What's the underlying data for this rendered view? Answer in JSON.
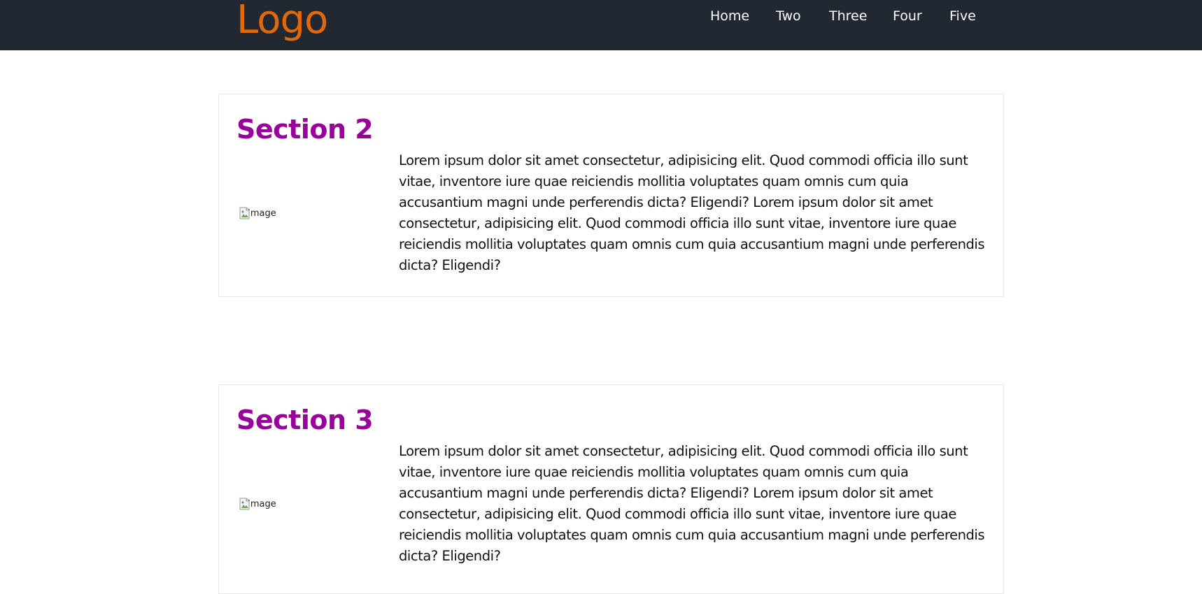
{
  "header": {
    "logo": "Logo",
    "nav": [
      {
        "label": "Home"
      },
      {
        "label": "Two"
      },
      {
        "label": "Three"
      },
      {
        "label": "Four"
      },
      {
        "label": "Five"
      }
    ]
  },
  "sections": [
    {
      "title": "Section 2",
      "image_alt": "Image",
      "text": "Lorem ipsum dolor sit amet consectetur, adipisicing elit. Quod commodi officia illo sunt vitae, inventore iure quae reiciendis mollitia voluptates quam omnis cum quia accusantium magni unde perferendis dicta? Eligendi? Lorem ipsum dolor sit amet consectetur, adipisicing elit. Quod commodi officia illo sunt vitae, inventore iure quae reiciendis mollitia voluptates quam omnis cum quia accusantium magni unde perferendis dicta? Eligendi?"
    },
    {
      "title": "Section 3",
      "image_alt": "Image",
      "text": "Lorem ipsum dolor sit amet consectetur, adipisicing elit. Quod commodi officia illo sunt vitae, inventore iure quae reiciendis mollitia voluptates quam omnis cum quia accusantium magni unde perferendis dicta? Eligendi? Lorem ipsum dolor sit amet consectetur, adipisicing elit. Quod commodi officia illo sunt vitae, inventore iure quae reiciendis mollitia voluptates quam omnis cum quia accusantium magni unde perferendis dicta? Eligendi?"
    }
  ],
  "colors": {
    "navbar_bg": "#222831",
    "logo": "#e0690b",
    "section_title": "#990099"
  }
}
